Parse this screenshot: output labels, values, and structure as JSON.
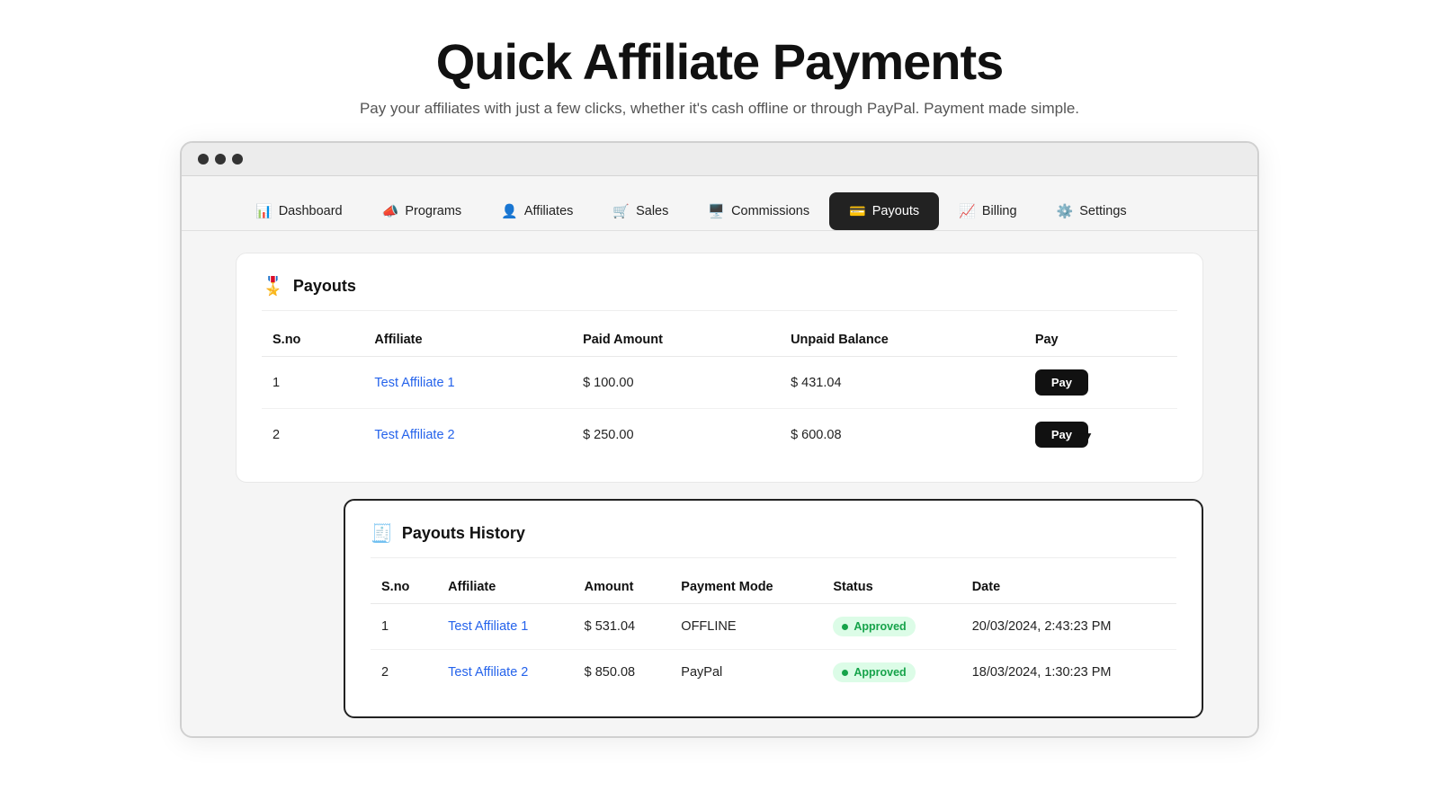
{
  "header": {
    "title": "Quick Affiliate Payments",
    "subtitle": "Pay your affiliates with just a few clicks, whether it's cash offline or through PayPal. Payment made simple."
  },
  "nav": {
    "items": [
      {
        "id": "dashboard",
        "label": "Dashboard",
        "icon": "📊",
        "active": false
      },
      {
        "id": "programs",
        "label": "Programs",
        "icon": "📣",
        "active": false
      },
      {
        "id": "affiliates",
        "label": "Affiliates",
        "icon": "👤",
        "active": false
      },
      {
        "id": "sales",
        "label": "Sales",
        "icon": "🛒",
        "active": false
      },
      {
        "id": "commissions",
        "label": "Commissions",
        "icon": "🖥️",
        "active": false
      },
      {
        "id": "payouts",
        "label": "Payouts",
        "icon": "💳",
        "active": true
      },
      {
        "id": "billing",
        "label": "Billing",
        "icon": "📈",
        "active": false
      },
      {
        "id": "settings",
        "label": "Settings",
        "icon": "⚙️",
        "active": false
      }
    ]
  },
  "payouts_table": {
    "title": "Payouts",
    "icon": "🎖️",
    "columns": [
      "S.no",
      "Affiliate",
      "Paid Amount",
      "Unpaid Balance",
      "Pay"
    ],
    "rows": [
      {
        "sno": "1",
        "affiliate": "Test Affiliate 1",
        "paid_amount": "$ 100.00",
        "unpaid_balance": "$ 431.04",
        "pay_label": "Pay"
      },
      {
        "sno": "2",
        "affiliate": "Test Affiliate 2",
        "paid_amount": "$ 250.00",
        "unpaid_balance": "$ 600.08",
        "pay_label": "Pay"
      }
    ]
  },
  "history_table": {
    "title": "Payouts History",
    "icon": "🧾",
    "columns": [
      "S.no",
      "Affiliate",
      "Amount",
      "Payment Mode",
      "Status",
      "Date"
    ],
    "rows": [
      {
        "sno": "1",
        "affiliate": "Test Affiliate 1",
        "amount": "$ 531.04",
        "payment_mode": "OFFLINE",
        "status": "Approved",
        "date": "20/03/2024, 2:43:23 PM"
      },
      {
        "sno": "2",
        "affiliate": "Test Affiliate 2",
        "amount": "$ 850.08",
        "payment_mode": "PayPal",
        "status": "Approved",
        "date": "18/03/2024, 1:30:23 PM"
      }
    ]
  }
}
